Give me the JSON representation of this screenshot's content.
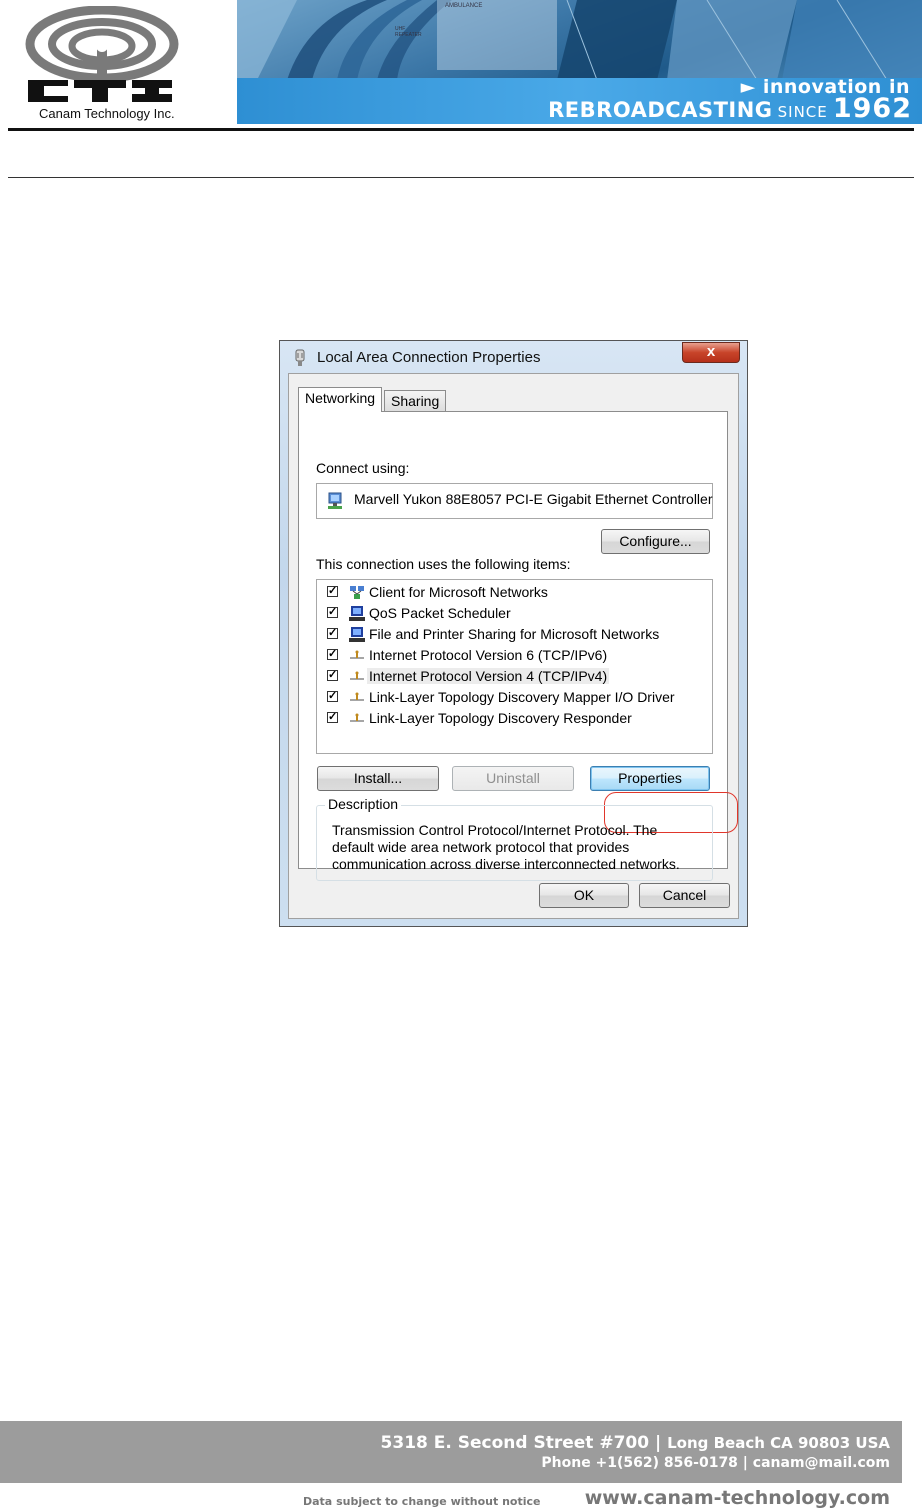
{
  "header": {
    "company_logo_text": "CTI",
    "company_name": "Canam Technology Inc.",
    "banner_line1": "► innovation in",
    "banner_big": "REBROADCASTING",
    "banner_since": "SINCE",
    "banner_year": "1962",
    "banner_small_text_1": "AMBULANCE",
    "banner_small_text_2": "UHF REPEATER"
  },
  "dialog": {
    "title": "Local Area Connection Properties",
    "close_label": "x",
    "tabs": [
      {
        "label": "Networking",
        "active": true
      },
      {
        "label": "Sharing",
        "active": false
      }
    ],
    "connect_using_label": "Connect using:",
    "adapter_name": "Marvell Yukon 88E8057 PCI-E Gigabit Ethernet Controller",
    "configure_button": "Configure...",
    "items_label": "This connection uses the following items:",
    "items": [
      {
        "label": "Client for Microsoft Networks",
        "checked": true,
        "icon": "network-client-icon"
      },
      {
        "label": "QoS Packet Scheduler",
        "checked": true,
        "icon": "network-service-icon"
      },
      {
        "label": "File and Printer Sharing for Microsoft Networks",
        "checked": true,
        "icon": "network-service-icon"
      },
      {
        "label": "Internet Protocol Version 6 (TCP/IPv6)",
        "checked": true,
        "icon": "protocol-icon"
      },
      {
        "label": "Internet Protocol Version 4 (TCP/IPv4)",
        "checked": true,
        "icon": "protocol-icon",
        "selected": true
      },
      {
        "label": "Link-Layer Topology Discovery Mapper I/O Driver",
        "checked": true,
        "icon": "protocol-icon"
      },
      {
        "label": "Link-Layer Topology Discovery Responder",
        "checked": true,
        "icon": "protocol-icon"
      }
    ],
    "install_button": "Install...",
    "uninstall_button": "Uninstall",
    "properties_button": "Properties",
    "description_legend": "Description",
    "description_text": "Transmission Control Protocol/Internet Protocol. The default wide area network protocol that provides communication across diverse interconnected networks.",
    "ok_button": "OK",
    "cancel_button": "Cancel"
  },
  "footer": {
    "address": "5318 E. Second Street  #700 |",
    "city": "Long Beach CA 90803 USA",
    "contact": "Phone +1(562) 856-0178 | canam@mail.com",
    "notice": "Data subject to change without notice",
    "website": "www.canam-technology.com"
  },
  "colors": {
    "banner_blue": "#2e8fd3",
    "highlight_ring": "#e0362b",
    "footer_gray": "#9c9c9c"
  }
}
